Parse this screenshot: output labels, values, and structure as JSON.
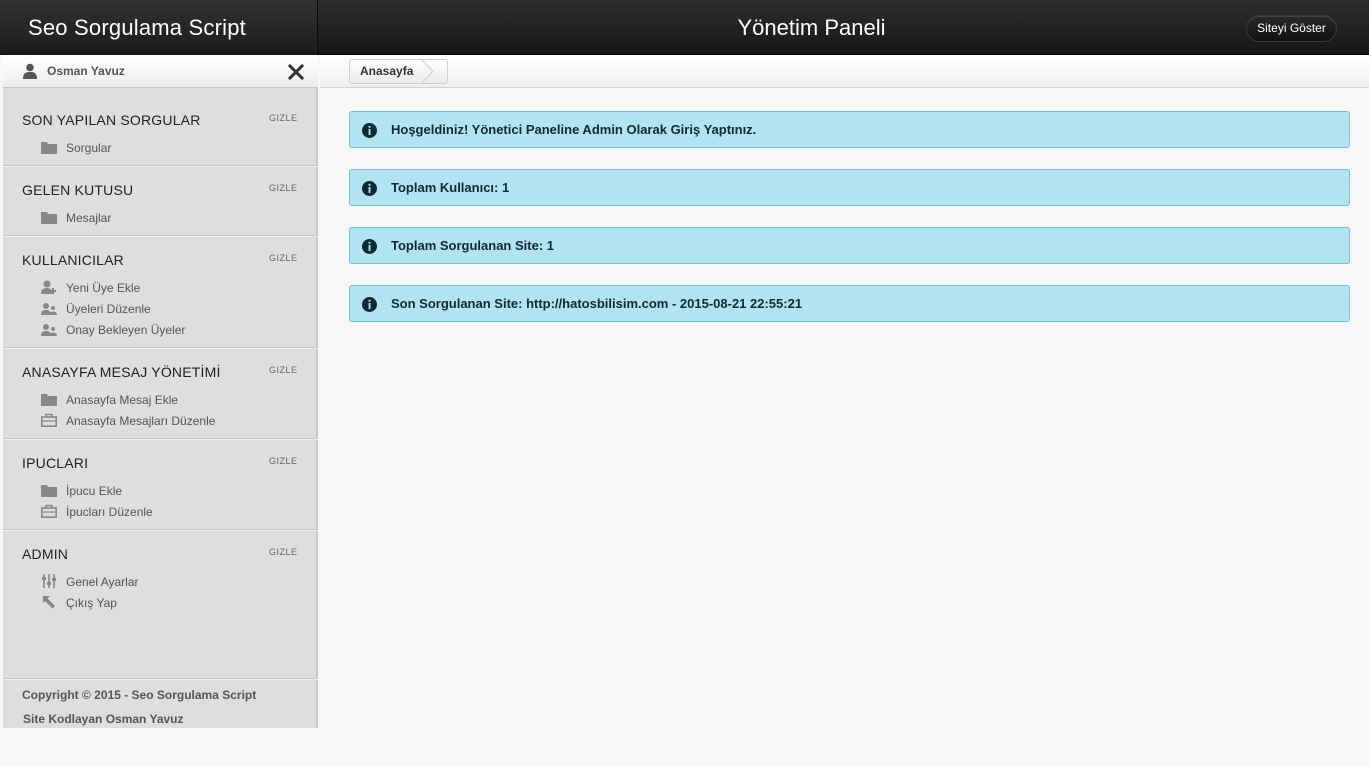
{
  "header": {
    "brand": "Seo Sorgulama Script",
    "title": "Yönetim Paneli",
    "show_site_label": "Siteyi Göster"
  },
  "user": {
    "name": "Osman Yavuz",
    "icon": "user-icon",
    "close_icon": "close-icon"
  },
  "sidebar": {
    "sections": [
      {
        "title": "SON YAPILAN SORGULAR",
        "hide": "GIZLE",
        "items": [
          {
            "label": "Sorgular",
            "icon": "folder-icon"
          }
        ]
      },
      {
        "title": "GELEN KUTUSU",
        "hide": "GIZLE",
        "items": [
          {
            "label": "Mesajlar",
            "icon": "folder-icon"
          }
        ]
      },
      {
        "title": "KULLANICILAR",
        "hide": "GIZLE",
        "items": [
          {
            "label": "Yeni Üye Ekle",
            "icon": "user-add-icon"
          },
          {
            "label": "Üyeleri Düzenle",
            "icon": "users-icon"
          },
          {
            "label": "Onay Bekleyen Üyeler",
            "icon": "users-icon"
          }
        ]
      },
      {
        "title": "ANASAYFA MESAJ YÖNETİMİ",
        "hide": "GIZLE",
        "items": [
          {
            "label": "Anasayfa Mesaj Ekle",
            "icon": "folder-icon"
          },
          {
            "label": "Anasayfa Mesajları Düzenle",
            "icon": "briefcase-icon"
          }
        ]
      },
      {
        "title": "IPUCLARI",
        "hide": "GIZLE",
        "items": [
          {
            "label": "İpucu Ekle",
            "icon": "folder-icon"
          },
          {
            "label": "İpucları Düzenle",
            "icon": "briefcase-icon"
          }
        ]
      },
      {
        "title": "ADMIN",
        "hide": "GIZLE",
        "items": [
          {
            "label": "Genel Ayarlar",
            "icon": "sliders-icon"
          },
          {
            "label": "Çıkış Yap",
            "icon": "arrow-up-left-icon"
          }
        ]
      }
    ],
    "footer": {
      "copyright": "Copyright © 2015 - Seo Sorgulama Script",
      "coder": "Site Kodlayan Osman Yavuz"
    }
  },
  "breadcrumb": {
    "home": "Anasayfa"
  },
  "alerts": [
    {
      "text": "Hoşgeldiniz! Yönetici Paneline Admin Olarak Giriş Yaptınız.",
      "icon": "info-icon"
    },
    {
      "text": "Toplam Kullanıcı: 1",
      "icon": "info-icon"
    },
    {
      "text": "Toplam Sorgulanan Site: 1",
      "icon": "info-icon"
    },
    {
      "text": "Son Sorgulanan Site: http://hatosbilisim.com - 2015-08-21 22:55:21",
      "icon": "info-icon"
    }
  ],
  "colors": {
    "alert_bg": "#b1e3f0",
    "alert_border": "#6fc0da",
    "header_bg": "#1b1b1b",
    "sidebar_bg": "#dedede"
  }
}
